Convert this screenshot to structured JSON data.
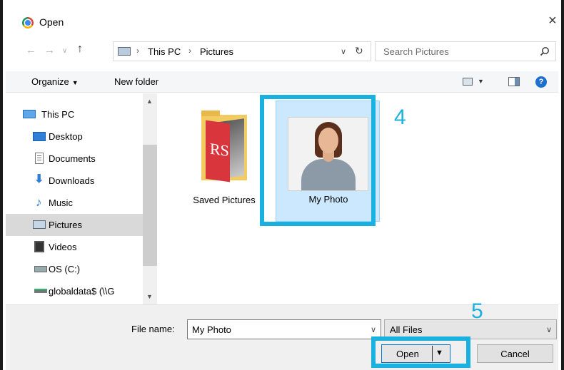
{
  "window": {
    "title": "Open",
    "close_glyph": "×"
  },
  "address_bar": {
    "back_glyph": "←",
    "forward_glyph": "→",
    "recent_glyph": "∨",
    "up_glyph": "↑",
    "crumbs": [
      "This PC",
      "Pictures"
    ],
    "crumb_separator": "›",
    "dropdown_glyph": "∨",
    "refresh_glyph": "↻"
  },
  "search": {
    "placeholder": "Search Pictures"
  },
  "toolbar": {
    "organize_label": "Organize",
    "organize_caret": "▼",
    "new_folder_label": "New folder",
    "view_caret": "▼",
    "help_glyph": "?"
  },
  "nav": {
    "scroll_up": "▲",
    "scroll_down": "▼",
    "items": [
      {
        "label": "This PC",
        "icon": "monitor-icon"
      },
      {
        "label": "Desktop",
        "icon": "desktop-icon"
      },
      {
        "label": "Documents",
        "icon": "documents-icon"
      },
      {
        "label": "Downloads",
        "icon": "downloads-icon"
      },
      {
        "label": "Music",
        "icon": "music-icon"
      },
      {
        "label": "Pictures",
        "icon": "pictures-icon",
        "selected": true
      },
      {
        "label": "Videos",
        "icon": "videos-icon"
      },
      {
        "label": "OS (C:)",
        "icon": "drive-icon"
      },
      {
        "label": "globaldata$ (\\\\G",
        "icon": "network-drive-icon"
      }
    ]
  },
  "files": [
    {
      "label": "Saved Pictures",
      "type": "folder"
    },
    {
      "label": "My Photo",
      "type": "image",
      "selected": true
    }
  ],
  "annotations": {
    "step4": "4",
    "step5": "5",
    "color": "#1ab0e0"
  },
  "bottom": {
    "file_name_label": "File name:",
    "file_name_value": "My Photo",
    "combo_glyph": "∨",
    "filter_value": "All Files",
    "open_label": "Open",
    "cancel_label": "Cancel"
  },
  "colors": {
    "selection": "#cce8ff",
    "accent": "#0078d7"
  }
}
